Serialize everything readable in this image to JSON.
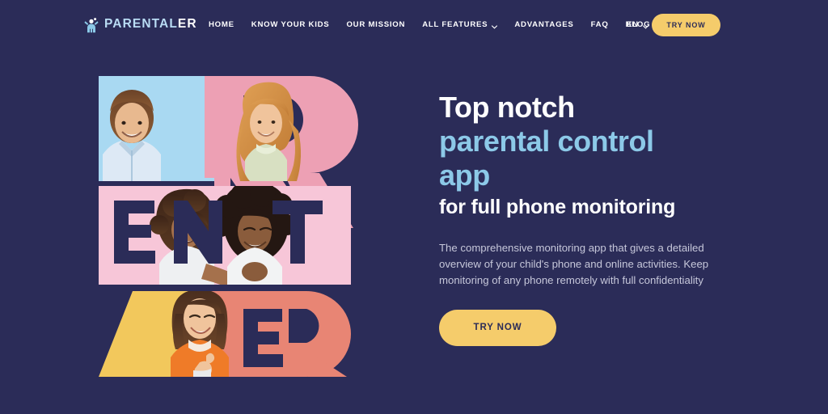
{
  "colors": {
    "background": "#2b2c58",
    "accent_yellow": "#f5cc6b",
    "accent_blue": "#8cc9e8",
    "text_light": "#ffffff",
    "text_muted": "#c6c7da",
    "block_lightblue": "#a9d9f2",
    "block_pink": "#eda0b4",
    "block_lightpink": "#f7c6d8",
    "block_yellow": "#f2c85c",
    "block_salmon": "#e88574"
  },
  "header": {
    "brand": {
      "name": "PARENTAL",
      "suffix": "ER",
      "icon": "child-raised-arms-icon"
    },
    "nav": [
      {
        "label": "HOME",
        "has_dropdown": false
      },
      {
        "label": "KNOW YOUR KIDS",
        "has_dropdown": false
      },
      {
        "label": "OUR MISSION",
        "has_dropdown": false
      },
      {
        "label": "ALL FEATURES",
        "has_dropdown": true
      },
      {
        "label": "ADVANTAGES",
        "has_dropdown": false
      },
      {
        "label": "FAQ",
        "has_dropdown": false
      },
      {
        "label": "BLOG",
        "has_dropdown": false
      }
    ],
    "language": {
      "label": "EN",
      "icon": "chevron-down-icon"
    },
    "cta_label": "TRY NOW"
  },
  "hero": {
    "headline_line1": "Top notch",
    "headline_line2": "parental control",
    "headline_line3": "app",
    "headline_sub": "for full phone monitoring",
    "paragraph": "The comprehensive monitoring app that gives a detailed overview of your child's phone and online activities. Keep monitoring of any phone remotely with full confidentiality",
    "cta_label": "TRY NOW",
    "collage": {
      "rows": [
        {
          "letters": "PAR",
          "blocks": [
            "PA light blue with boy photo",
            "R pink with girl photo"
          ]
        },
        {
          "letters": "ENT",
          "blocks": [
            "light pink band with two women embracing"
          ]
        },
        {
          "letters": "AER",
          "blocks": [
            "A yellow triangle",
            "ER salmon with woman in orange sweater"
          ]
        }
      ],
      "word": "PARENTALER"
    }
  }
}
